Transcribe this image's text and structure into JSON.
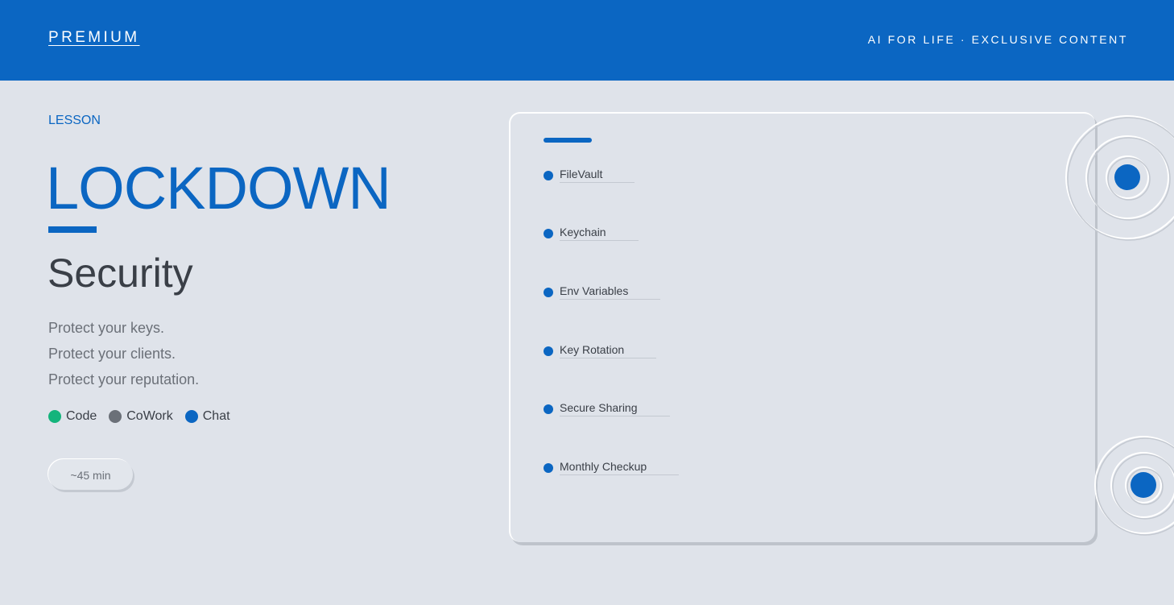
{
  "header": {
    "brand": "PREMIUM",
    "tagline": "AI FOR LIFE · EXCLUSIVE CONTENT",
    "background": "#0b66c2"
  },
  "lesson": {
    "kicker": "LESSON",
    "title": "LOCKDOWN",
    "subtitle": "Security",
    "lines": [
      "Protect your keys.",
      "Protect your clients.",
      "Protect your reputation."
    ],
    "platforms": [
      {
        "label": "Code",
        "color": "#14b47c"
      },
      {
        "label": "CoWork",
        "color": "#6b7078"
      },
      {
        "label": "Chat",
        "color": "#0b66c2"
      }
    ],
    "duration": "~45 min"
  },
  "topics": {
    "items": [
      "FileVault",
      "Keychain",
      "Env Variables",
      "Key Rotation",
      "Secure Sharing",
      "Monthly Checkup"
    ]
  },
  "colors": {
    "accent": "#0b66c2",
    "page": "#dfe3ea",
    "text_dark": "#3a3f47",
    "text_muted": "#6b7078"
  }
}
